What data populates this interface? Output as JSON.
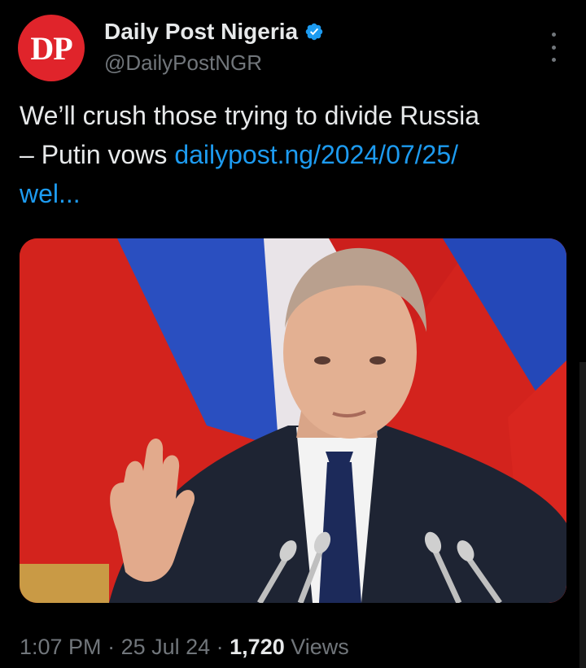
{
  "colors": {
    "background": "#000000",
    "text_primary": "#e7e9ea",
    "text_secondary": "#71767b",
    "link": "#1d9bf0",
    "verified": "#1d9bf0",
    "avatar_bg": "#e0242b"
  },
  "account": {
    "avatar_text": "DP",
    "display_name": "Daily Post Nigeria",
    "handle": "@DailyPostNGR",
    "verified_icon": "verified-badge-icon"
  },
  "menu": {
    "icon": "more-options-icon"
  },
  "tweet": {
    "text_part1": "We’ll crush those trying to divide Russia",
    "text_part2": "– Putin vows ",
    "link_text": "dailypost.ng/2024/07/25/",
    "link_text_2": "wel..."
  },
  "media": {
    "icon": "photo-attachment"
  },
  "meta": {
    "time": "1:07 PM",
    "sep1": " · ",
    "date": "25 Jul 24",
    "sep2": " · ",
    "views_count": "1,720",
    "views_label": " Views"
  }
}
